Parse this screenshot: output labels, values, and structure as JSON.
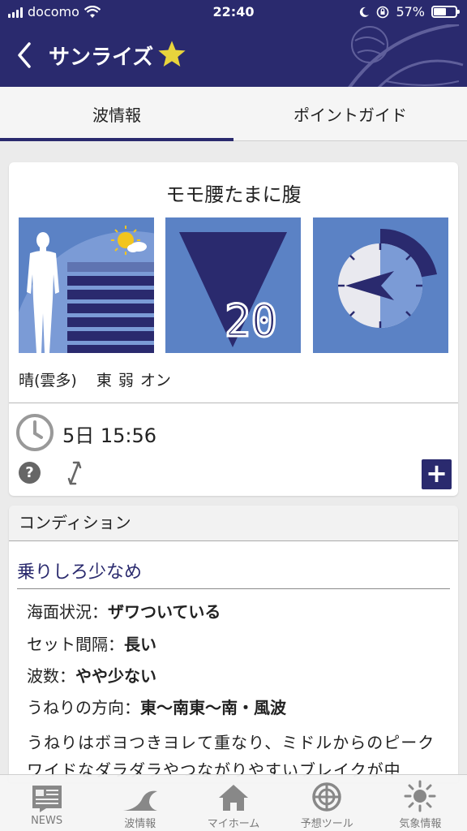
{
  "status_bar": {
    "carrier": "docomo",
    "time": "22:40",
    "battery": "57%",
    "battery_level": 0.57
  },
  "header": {
    "title": "サンライズ",
    "favorite": true
  },
  "tabs": [
    {
      "label": "波情報",
      "active": true
    },
    {
      "label": "ポイントガイド",
      "active": false
    }
  ],
  "wave": {
    "size": "モモ腰たまに腹",
    "period": "20",
    "weather": "晴(雲多)",
    "wind_direction": "東",
    "wind_strength": "弱",
    "wind_type": "オン",
    "updated": "5日 15:56"
  },
  "condition": {
    "header": "コンディション",
    "title": "乗りしろ少なめ",
    "rows": [
      {
        "label": "海面状況：",
        "value": "ザワついている"
      },
      {
        "label": "セット間隔：",
        "value": "長い"
      },
      {
        "label": "波数：",
        "value": "やや少ない"
      },
      {
        "label": "うねりの方向：",
        "value": "東〜南東〜南・風波"
      }
    ],
    "description": "うねりはボヨつきヨレて重なり、ミドルからのピークワイドなダラダラやつながりやすいブレイクが中"
  },
  "nav": [
    {
      "label": "NEWS",
      "icon": "news-icon"
    },
    {
      "label": "波情報",
      "icon": "wave-icon"
    },
    {
      "label": "マイホーム",
      "icon": "home-icon"
    },
    {
      "label": "予想ツール",
      "icon": "forecast-icon"
    },
    {
      "label": "気象情報",
      "icon": "weather-icon"
    }
  ],
  "colors": {
    "primary": "#2a2a6e",
    "panel": "#5b82c5",
    "star": "#e8d43c"
  }
}
